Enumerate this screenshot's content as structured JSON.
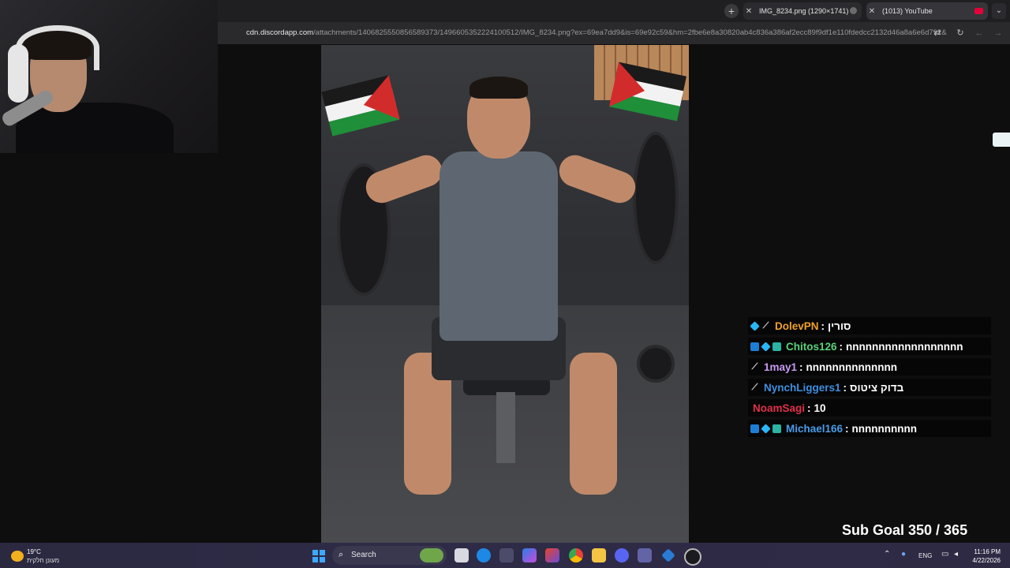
{
  "browser": {
    "new_tab_symbol": "+",
    "tabs": [
      {
        "close": "✕",
        "title": "IMG_8234.png (1290×1741)",
        "favicon": "discord-icon"
      },
      {
        "close": "✕",
        "title": "(1013) YouTube",
        "favicon": "youtube-icon"
      }
    ],
    "tab_menu": "⌄",
    "url_host": "cdn.discordapp.com",
    "url_path": "/attachments/1406825550856589373/1496605352224100512/IMG_8234.png?ex=69ea7dd9&is=69e92c59&hm=2fbe6e8a30820ab4c836a386af2ecc89f9df1e110fdedcc2132d46a8a6e6d792&",
    "reload_symbol": "↻",
    "back_symbol": "←",
    "forward_symbol": "→"
  },
  "chat": {
    "messages": [
      {
        "badges": [
          "cube-badge",
          "pen-badge"
        ],
        "user": "DolevPN",
        "user_color": "#f0a22a",
        "text": "סורין"
      },
      {
        "badges": [
          "prime-badge",
          "cube-badge",
          "sub-badge"
        ],
        "user": "Chitos126",
        "user_color": "#5ad17b",
        "text": "nnnnnnnnnnnnnnnnnn"
      },
      {
        "badges": [
          "pen-badge"
        ],
        "user": "1may1",
        "user_color": "#c79bf2",
        "text": "nnnnnnnnnnnnnn"
      },
      {
        "badges": [
          "pen-badge"
        ],
        "user": "NynchLiggers1",
        "user_color": "#3d8ee0",
        "text": "בדוק ציטוס"
      },
      {
        "badges": [],
        "user": "NoamSagi",
        "user_color": "#e0304a",
        "text": "10"
      },
      {
        "badges": [
          "prime-badge",
          "cube-badge",
          "sub-badge"
        ],
        "user": "Michael166",
        "user_color": "#4a9be8",
        "text": "nnnnnnnnnn"
      }
    ],
    "separator": ":"
  },
  "sub_goal": "Sub Goal 350 / 365",
  "taskbar": {
    "weather_temp": "19°C",
    "weather_desc": "מעונן חלקית",
    "search_placeholder": "Search",
    "apps": [
      "file-explorer-icon",
      "edge-icon",
      "store-icon",
      "copilot-icon",
      "office-icon",
      "chrome-icon",
      "folder-icon",
      "discord-icon",
      "teams-icon",
      "vscode-icon",
      "obs-icon"
    ],
    "language": "ENG",
    "time": "11:16 PM",
    "date": "4/22/2026"
  },
  "colors": {
    "accent": "#3ea8ff",
    "chat_bg": "rgba(0,0,0,0.55)"
  }
}
